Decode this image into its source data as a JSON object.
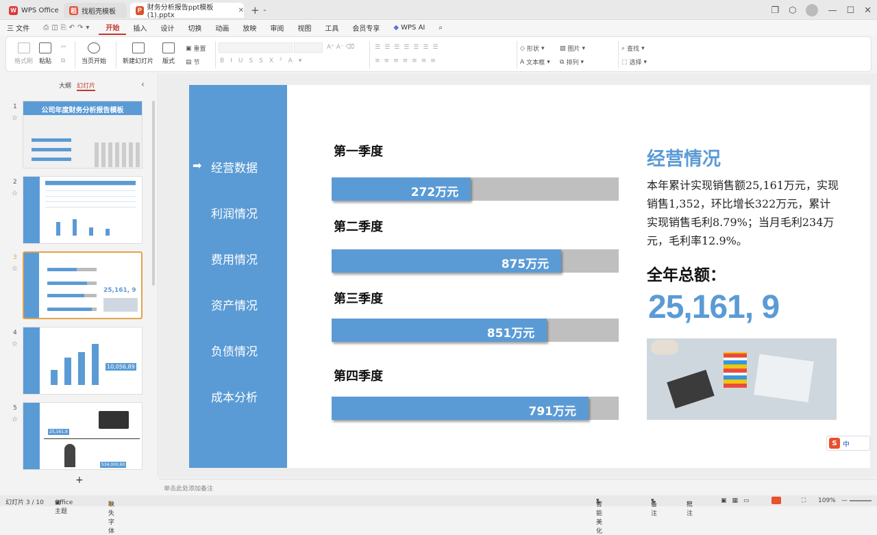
{
  "tabs": {
    "wps": "WPS Office",
    "template": "找稻壳模板",
    "doc": "财务分析报告ppt模板(1).pptx"
  },
  "menu": [
    "三 文件",
    "开始",
    "插入",
    "设计",
    "切换",
    "动画",
    "放映",
    "审阅",
    "视图",
    "工具",
    "会员专享",
    "WPS AI"
  ],
  "ribbon": {
    "format_painter": "格式刷",
    "paste": "粘贴",
    "start_from_current": "当页开始",
    "new_slide": "新建幻灯片",
    "layout": "版式",
    "reset": "重置",
    "section": "节",
    "shape": "形状",
    "picture": "图片",
    "textbox": "文本框",
    "arrange": "排列",
    "find": "查找",
    "select": "选择"
  },
  "panel": {
    "outline_tab": "大纲",
    "slides_tab": "幻灯片",
    "thumb1_title": "公司年度财务分析报告模板",
    "thumb3_big": "25,161, 9",
    "thumb4_big": "10,056,89",
    "thumb5_a": "25,161,9",
    "thumb5_b": "534,000,60"
  },
  "slide": {
    "nav": [
      "经营数据",
      "利润情况",
      "费用情况",
      "资产情况",
      "负债情况",
      "成本分析"
    ],
    "active_nav": 0,
    "quarters": [
      {
        "label": "第一季度",
        "value": "272万元",
        "fill": 0.485
      },
      {
        "label": "第二季度",
        "value": "875万元",
        "fill": 0.8
      },
      {
        "label": "第三季度",
        "value": "851万元",
        "fill": 0.75
      },
      {
        "label": "第四季度",
        "value": "791万元",
        "fill": 0.895
      }
    ],
    "heading": "经营情况",
    "body": "本年累计实现销售额25,161万元，实现销售1,352，环比增长322万元，累计实现销售毛利8.79%；当月毛利234万元，毛利率12.9%。",
    "total_label": "全年总额：",
    "total_value": "25,161, 9"
  },
  "notes_placeholder": "单击此处添加备注",
  "status": {
    "slide_count": "幻灯片 3 / 10",
    "theme": "Office 主题",
    "missing_font": "缺失字体",
    "smart": "智能美化",
    "notes": "备注",
    "comments": "批注",
    "zoom": "109%"
  },
  "colors": {
    "accent_blue": "#5b9bd5",
    "bar_gray": "#bfbfbf",
    "wps_red": "#c0392b"
  }
}
